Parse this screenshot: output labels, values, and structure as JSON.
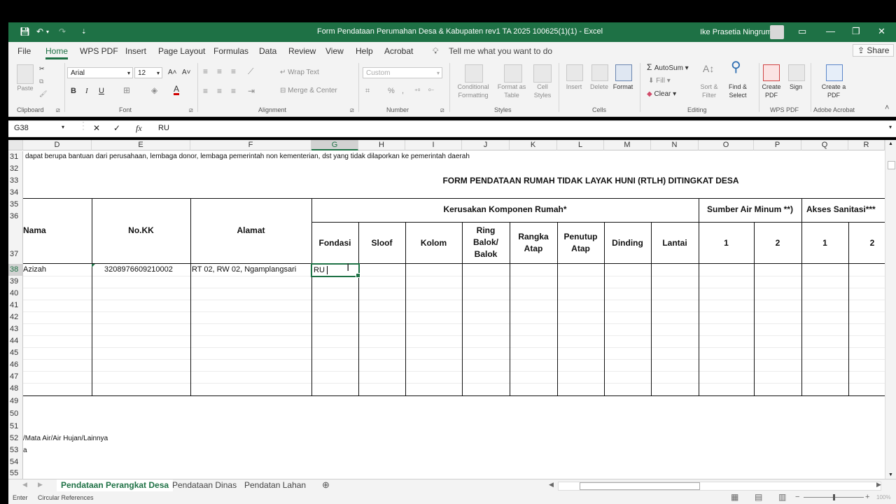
{
  "window": {
    "title": "Form Pendataan Perumahan Desa & Kabupaten rev1 TA 2025 100625(1)(1)  -  Excel",
    "user": "Ike Prasetia Ningrum",
    "share": "Share"
  },
  "menu": {
    "tabs": [
      "File",
      "Home",
      "WPS PDF",
      "Insert",
      "Page Layout",
      "Formulas",
      "Data",
      "Review",
      "View",
      "Help",
      "Acrobat"
    ],
    "active": "Home",
    "tell_me": "Tell me what you want to do"
  },
  "ribbon": {
    "clipboard": {
      "paste": "Paste",
      "label": "Clipboard"
    },
    "font": {
      "name": "Arial",
      "size": "12",
      "label": "Font",
      "bold": "B",
      "italic": "I",
      "underline": "U"
    },
    "alignment": {
      "wrap": "Wrap Text",
      "merge": "Merge & Center",
      "label": "Alignment"
    },
    "number": {
      "format": "Custom",
      "label": "Number"
    },
    "styles": {
      "cond": "Conditional Formatting",
      "table": "Format as Table",
      "cell": "Cell Styles",
      "label": "Styles"
    },
    "cells": {
      "insert": "Insert",
      "delete": "Delete",
      "format": "Format",
      "label": "Cells"
    },
    "editing": {
      "autosum": "AutoSum",
      "fill": "Fill",
      "clear": "Clear",
      "sort": "Sort & Filter",
      "find": "Find & Select",
      "label": "Editing"
    },
    "wps": {
      "create": "Create PDF",
      "sign": "Sign",
      "label": "WPS PDF"
    },
    "acrobat": {
      "create": "Create a PDF",
      "label": "Adobe Acrobat"
    }
  },
  "formula_bar": {
    "name_box": "G38",
    "cancel": "✕",
    "enter": "✓",
    "fx": "fx",
    "content": "RU"
  },
  "columns": [
    "D",
    "E",
    "F",
    "G",
    "H",
    "I",
    "J",
    "K",
    "L",
    "M",
    "N",
    "O",
    "P",
    "Q",
    "R"
  ],
  "selected_column": "G",
  "rows": [
    "31",
    "32",
    "33",
    "34",
    "35",
    "36",
    "37",
    "38",
    "39",
    "40",
    "41",
    "42",
    "43",
    "44",
    "45",
    "46",
    "47",
    "48",
    "49",
    "50",
    "51",
    "52",
    "53",
    "54",
    "55"
  ],
  "sheet": {
    "note_row31": "dapat berupa bantuan dari perusahaan, lembaga donor, lembaga pemerintah non kementerian, dst yang  tidak dilaporkan ke pemerintah daerah",
    "form_title": "FORM PENDATAAN RUMAH TIDAK LAYAK HUNI  (RTLH) DITINGKAT DESA",
    "headers": {
      "nama": "Nama",
      "no_kk": "No.KK",
      "alamat": "Alamat",
      "kerusakan": "Kerusakan Komponen Rumah*",
      "sumber_air": "Sumber Air Minum **)",
      "sanitasi": "Akses Sanitasi***",
      "fondasi": "Fondasi",
      "sloof": "Sloof",
      "kolom": "Kolom",
      "ring_balok": "Ring Balok/ Balok",
      "rangka_atap": "Rangka Atap",
      "penutup_atap": "Penutup Atap",
      "dinding": "Dinding",
      "lantai": "Lantai",
      "air1": "1",
      "air2": "2",
      "san1": "1",
      "san2": "2"
    },
    "row38": {
      "nama": "Azizah",
      "no_kk": "3208976609210002",
      "alamat": "RT 02, RW 02, Ngamplangsari",
      "fondasi": "RU"
    },
    "note_row52": "/Mata Air/Air Hujan/Lainnya",
    "note_row53": "a"
  },
  "sheet_tabs": [
    "Pendataan Perangkat Desa",
    "Pendataan Dinas",
    "Pendatan Lahan"
  ],
  "active_sheet": "Pendataan Perangkat Desa",
  "status": {
    "mode": "Enter",
    "circular": "Circular References",
    "zoom": "100%"
  }
}
